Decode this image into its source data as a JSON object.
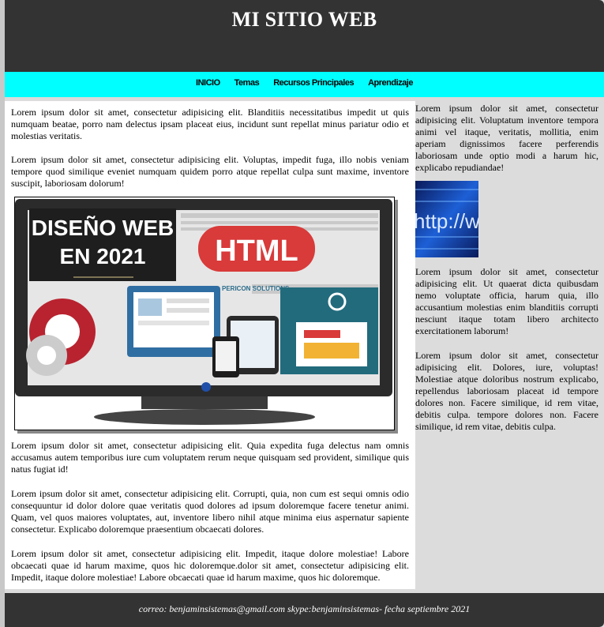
{
  "header": {
    "title": "MI SITIO WEB"
  },
  "nav": {
    "items": [
      {
        "label": "INICIO"
      },
      {
        "label": "Temas"
      },
      {
        "label": "Recursos Principales"
      },
      {
        "label": "Aprendizaje"
      }
    ]
  },
  "main": {
    "paragraphs": [
      "Lorem ipsum dolor sit amet, consectetur adipisicing elit. Blanditiis necessitatibus impedit ut quis numquam beatae, porro nam delectus ipsam placeat eius, incidunt sunt repellat minus pariatur odio et molestias veritatis.",
      "Lorem ipsum dolor sit amet, consectetur adipisicing elit. Voluptas, impedit fuga, illo nobis veniam tempore quod similique eveniet numquam quidem porro atque repellat culpa sunt maxime, inventore suscipit, laboriosam dolorum!",
      "Lorem ipsum dolor sit amet, consectetur adipisicing elit. Quia expedita fuga delectus nam omnis accusamus autem temporibus iure cum voluptatem rerum neque quisquam sed provident, similique quis natus fugiat id!",
      "Lorem ipsum dolor sit amet, consectetur adipisicing elit. Corrupti, quia, non cum est sequi omnis odio consequuntur id dolor dolore quae veritatis quod dolores ad ipsum doloremque facere tenetur animi. Quam, vel quos maiores voluptates, aut, inventore libero nihil atque minima eius aspernatur sapiente consectetur. Explicabo doloremque praesentium obcaecati dolores.",
      "Lorem ipsum dolor sit amet, consectetur adipisicing elit. Impedit, itaque dolore molestiae! Labore obcaecati quae id harum maxime, quos hic doloremque.dolor sit amet, consectetur adipisicing elit. Impedit, itaque dolore molestiae! Labore obcaecati quae id harum maxime, quos hic doloremque."
    ],
    "hero": {
      "line1": "DISEÑO WEB",
      "line2": "EN 2021",
      "html_label": "HTML",
      "brand": "PERICON SOLUTIONS"
    }
  },
  "sidebar": {
    "paragraphs": [
      "Lorem ipsum dolor sit amet, consectetur adipisicing elit. Voluptatum inventore tempora animi vel itaque, veritatis, mollitia, enim aperiam dignissimos facere perferendis laboriosam unde optio modi a harum hic, explicabo repudiandae!",
      "Lorem ipsum dolor sit amet, consectetur adipisicing elit. Ut quaerat dicta quibusdam nemo voluptate officia, harum quia, illo accusantium molestias enim blanditiis corrupti nesciunt itaque totam libero architecto exercitationem laborum!",
      "Lorem ipsum dolor sit amet, consectetur adipisicing elit. Dolores, iure, voluptas! Molestiae atque doloribus nostrum explicabo, repellendus laboriosam placeat id tempore dolores non. Facere similique, id rem vitae, debitis culpa. tempore dolores non. Facere similique, id rem vitae, debitis culpa."
    ],
    "image_text": "http://www"
  },
  "footer": {
    "text": "correo: benjaminsistemas@gmail.com skype:benjaminsistemas- fecha septiembre 2021"
  },
  "colors": {
    "header_bg": "#333333",
    "nav_bg": "#00ffff",
    "page_bg": "#dcdcdc"
  }
}
